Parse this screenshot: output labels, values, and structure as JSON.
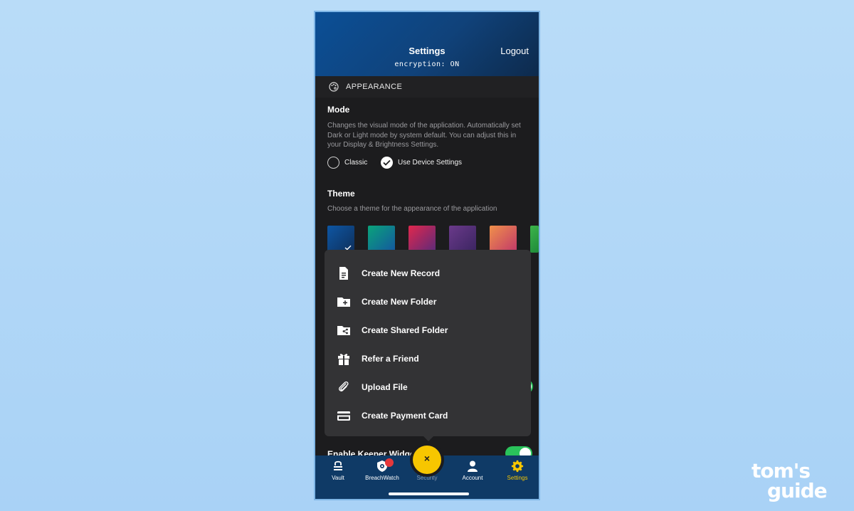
{
  "header": {
    "title": "Settings",
    "logout": "Logout",
    "encryption": "encryption: ON"
  },
  "appearance": {
    "section_label": "APPEARANCE",
    "mode_title": "Mode",
    "mode_description": "Changes the visual mode of the application. Automatically set Dark or Light mode by system default. You can adjust this in your Display & Brightness Settings.",
    "mode_options": [
      {
        "label": "Classic",
        "selected": false
      },
      {
        "label": "Use Device Settings",
        "selected": true
      }
    ],
    "theme_title": "Theme",
    "theme_description": "Choose a theme for the appearance of the application",
    "themes": [
      {
        "name": "blue",
        "selected": true
      },
      {
        "name": "teal",
        "selected": false
      },
      {
        "name": "crimson",
        "selected": false
      },
      {
        "name": "purple",
        "selected": false
      },
      {
        "name": "coral",
        "selected": false
      },
      {
        "name": "green",
        "selected": false
      }
    ]
  },
  "hidden_setting": {
    "label": "Enable Keeper Widget",
    "enabled": true
  },
  "menu": {
    "items": [
      {
        "label": "Create New Record",
        "icon": "document-icon"
      },
      {
        "label": "Create New Folder",
        "icon": "folder-plus-icon"
      },
      {
        "label": "Create Shared Folder",
        "icon": "shared-folder-icon"
      },
      {
        "label": "Refer a Friend",
        "icon": "gift-icon"
      },
      {
        "label": "Upload File",
        "icon": "paperclip-icon"
      },
      {
        "label": "Create Payment Card",
        "icon": "credit-card-icon"
      }
    ]
  },
  "fab": {
    "label": "×"
  },
  "tabs": [
    {
      "label": "Vault",
      "icon": "vault-icon",
      "active": false
    },
    {
      "label": "BreachWatch",
      "icon": "breachwatch-icon",
      "active": false
    },
    {
      "label": "Security",
      "icon": "security-icon",
      "active": false
    },
    {
      "label": "Account",
      "icon": "account-icon",
      "active": false
    },
    {
      "label": "Settings",
      "icon": "gear-icon",
      "active": true
    }
  ],
  "colors": {
    "accent": "#f7c600",
    "header": "#0b4f96",
    "toggle": "#2ac35b",
    "badge": "#e5383b"
  },
  "watermark": {
    "line1": "tom's",
    "line2": "guide"
  }
}
